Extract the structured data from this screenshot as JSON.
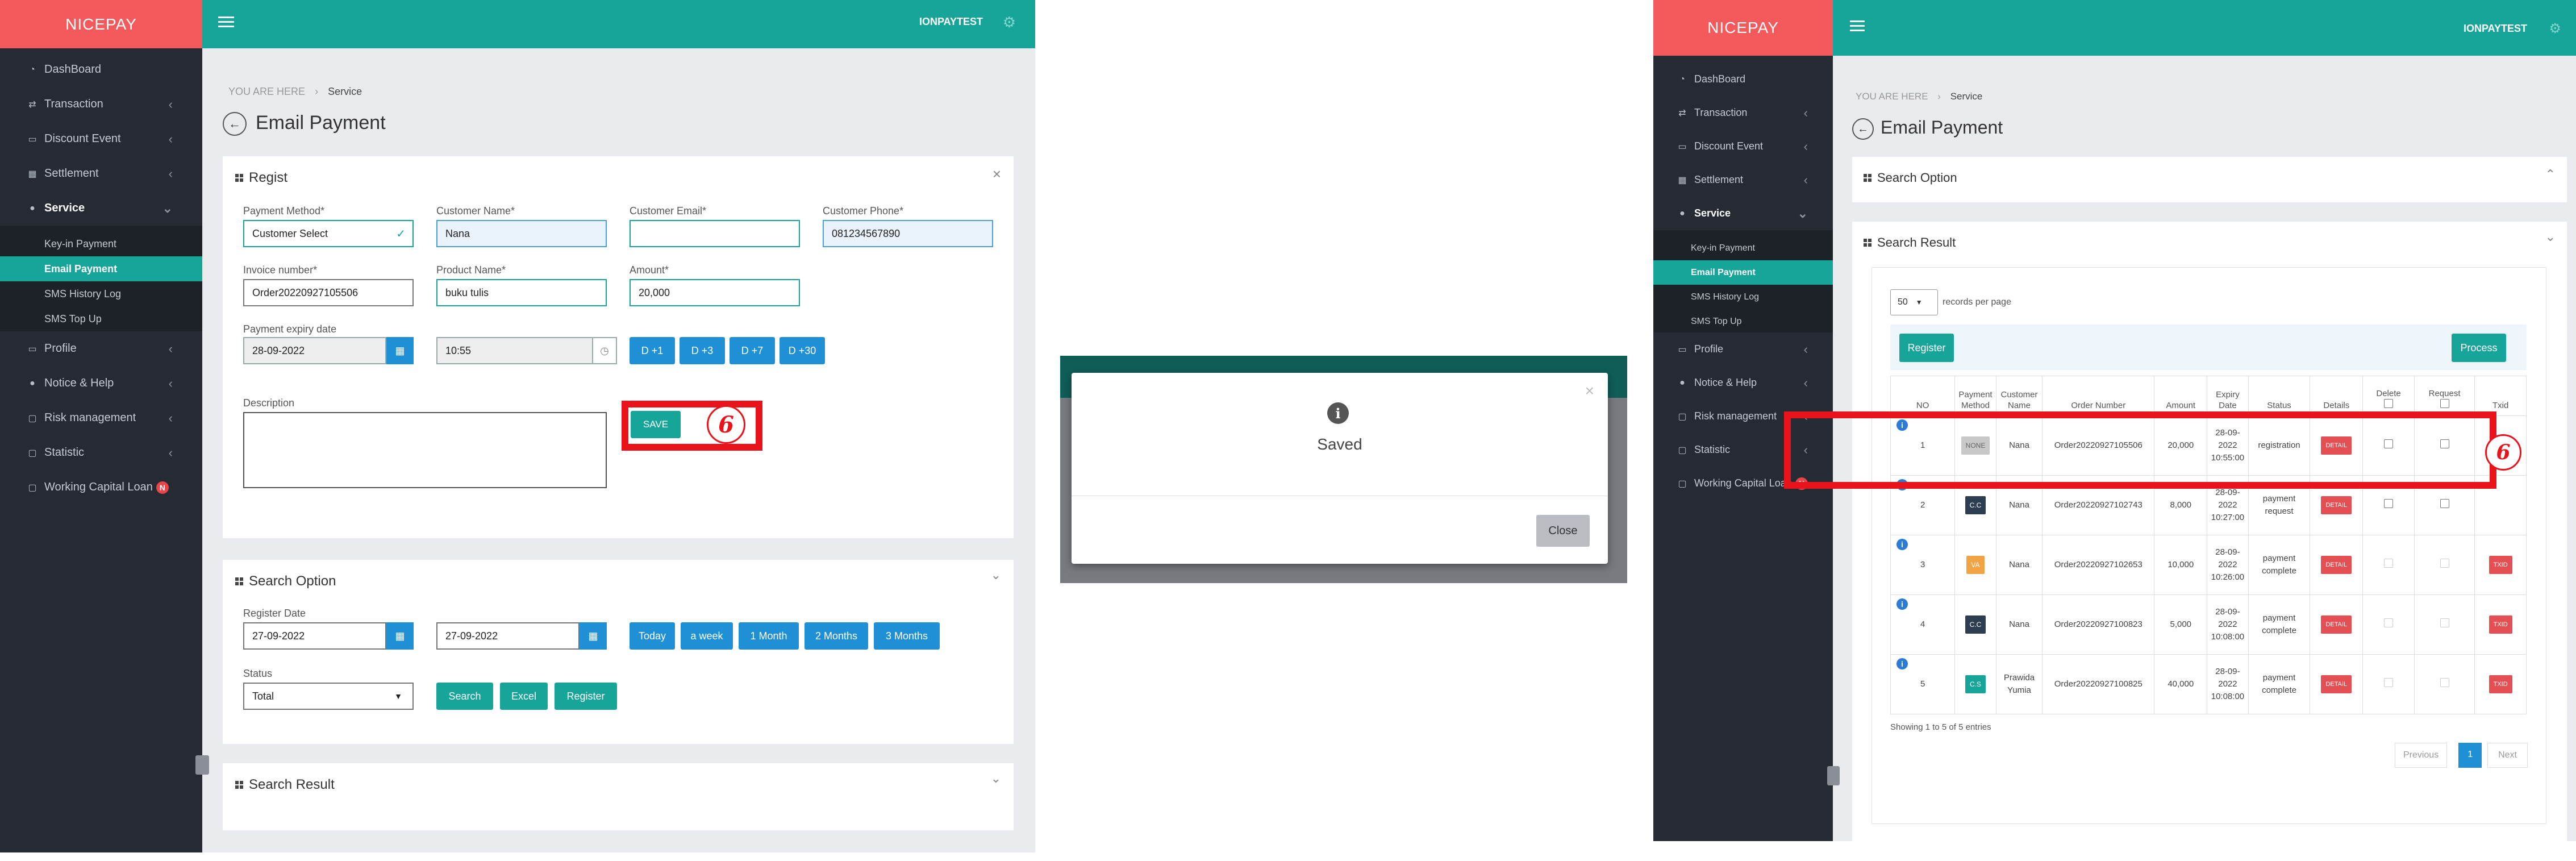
{
  "brand": "NICEPAY",
  "user": "IONPAYTEST",
  "nav": [
    {
      "label": "DashBoard",
      "icon": "dashboard-icon"
    },
    {
      "label": "Transaction",
      "icon": "transfer-icon"
    },
    {
      "label": "Discount Event",
      "icon": "credit-card-icon"
    },
    {
      "label": "Settlement",
      "icon": "calendar-icon"
    },
    {
      "label": "Service",
      "icon": "users-icon"
    },
    {
      "label": "Profile",
      "icon": "monitor-icon"
    },
    {
      "label": "Notice & Help",
      "icon": "chat-icon"
    },
    {
      "label": "Risk management",
      "icon": "folder-icon"
    },
    {
      "label": "Statistic",
      "icon": "folder-icon"
    },
    {
      "label": "Working Capital Loan",
      "icon": "folder-icon",
      "badge": "N"
    }
  ],
  "service_sub": [
    "Key-in Payment",
    "Email Payment",
    "SMS History Log",
    "SMS Top Up"
  ],
  "breadcrumb": {
    "prefix": "YOU ARE HERE",
    "current": "Service"
  },
  "page_title": "Email Payment",
  "regist": {
    "title": "Regist",
    "payment_method": {
      "label": "Payment Method*",
      "value": "Customer Select"
    },
    "customer_name": {
      "label": "Customer Name*",
      "value": "Nana"
    },
    "customer_email": {
      "label": "Customer Email*",
      "value": ""
    },
    "customer_phone": {
      "label": "Customer Phone*",
      "value": "081234567890"
    },
    "invoice": {
      "label": "Invoice number*",
      "value": "Order20220927105506"
    },
    "product": {
      "label": "Product Name*",
      "value": "buku tulis"
    },
    "amount": {
      "label": "Amount*",
      "value": "20,000"
    },
    "expiry": {
      "label": "Payment expiry date",
      "date": "28-09-2022",
      "time": "10:55"
    },
    "quick_days": [
      "D +1",
      "D +3",
      "D +7",
      "D +30"
    ],
    "description_label": "Description",
    "save_label": "SAVE"
  },
  "step_marker": "6",
  "search_option": {
    "title": "Search Option",
    "register_date_label": "Register Date",
    "date_from": "27-09-2022",
    "date_to": "27-09-2022",
    "ranges": [
      "Today",
      "a week",
      "1 Month",
      "2 Months",
      "3 Months"
    ],
    "status_label": "Status",
    "status_value": "Total",
    "search_btn": "Search",
    "excel_btn": "Excel",
    "register_btn": "Register"
  },
  "search_result_title": "Search Result",
  "modal": {
    "title": "Saved",
    "close_label": "Close"
  },
  "result": {
    "records_per_page": "50",
    "records_label": "records per page",
    "register_btn": "Register",
    "process_btn": "Process",
    "columns": [
      "NO",
      "Payment Method",
      "Customer Name",
      "Order Number",
      "Amount",
      "Expiry Date",
      "Status",
      "Details",
      "Delete",
      "Request",
      "Txid"
    ],
    "rows": [
      {
        "no": "1",
        "method": "NONE",
        "method_color": "#c8c8c8",
        "name": "Nana",
        "order": "Order20220927105506",
        "amount": "20,000",
        "expiry": "28-09-2022 10:55:00",
        "status": "registration",
        "txid": ""
      },
      {
        "no": "2",
        "method": "C.C",
        "method_color": "#2c3e50",
        "name": "Nana",
        "order": "Order20220927102743",
        "amount": "8,000",
        "expiry": "28-09-2022 10:27:00",
        "status": "payment request",
        "txid": ""
      },
      {
        "no": "3",
        "method": "VA",
        "method_color": "#f2a444",
        "name": "Nana",
        "order": "Order20220927102653",
        "amount": "10,000",
        "expiry": "28-09-2022 10:26:00",
        "status": "payment complete",
        "txid": "TXID"
      },
      {
        "no": "4",
        "method": "C.C",
        "method_color": "#2c3e50",
        "name": "Nana",
        "order": "Order20220927100823",
        "amount": "5,000",
        "expiry": "28-09-2022 10:08:00",
        "status": "payment complete",
        "txid": "TXID"
      },
      {
        "no": "5",
        "method": "C.S",
        "method_color": "#17a499",
        "name": "Prawida Yumia",
        "order": "Order20220927100825",
        "amount": "40,000",
        "expiry": "28-09-2022 10:08:00",
        "status": "payment complete",
        "txid": "TXID"
      }
    ],
    "detail_label": "DETAIL",
    "showing": "Showing 1 to 5 of 5 entries",
    "prev": "Previous",
    "page": "1",
    "next": "Next"
  },
  "colors": {
    "teal": "#17a499",
    "coral": "#f4595b",
    "sidebar": "#252a33",
    "blue": "#1f90d6",
    "red": "#e34f53",
    "marker": "#e8131b"
  }
}
